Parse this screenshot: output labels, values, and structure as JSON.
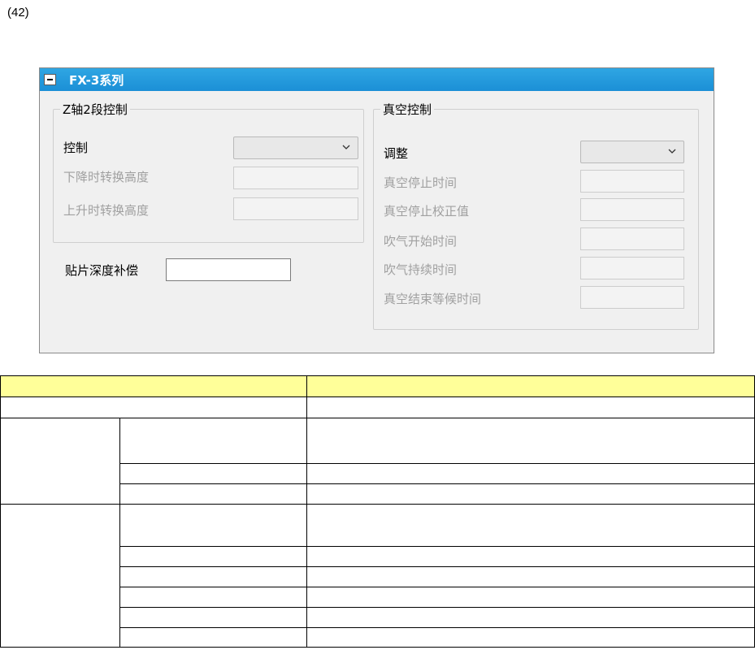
{
  "page": {
    "number_label": "(42)"
  },
  "window": {
    "title": "FX-3系列",
    "z_group": {
      "legend": "Z轴2段控制",
      "control_label": "控制",
      "control_value": "",
      "descend_label": "下降时转换高度",
      "ascend_label": "上升时转换高度",
      "descend_value": "",
      "ascend_value": ""
    },
    "depth_comp": {
      "label": "贴片深度补偿",
      "value": ""
    },
    "vac_group": {
      "legend": "真空控制",
      "adjust_label": "调整",
      "adjust_value": "",
      "items": [
        {
          "label": "真空停止时间",
          "value": ""
        },
        {
          "label": "真空停止校正值",
          "value": ""
        },
        {
          "label": "吹气开始时间",
          "value": ""
        },
        {
          "label": "吹气持续时间",
          "value": ""
        },
        {
          "label": "真空结束等候时间",
          "value": ""
        }
      ]
    }
  },
  "colors": {
    "titlebar": "#1b8fd6",
    "table_header": "#ffff99"
  }
}
